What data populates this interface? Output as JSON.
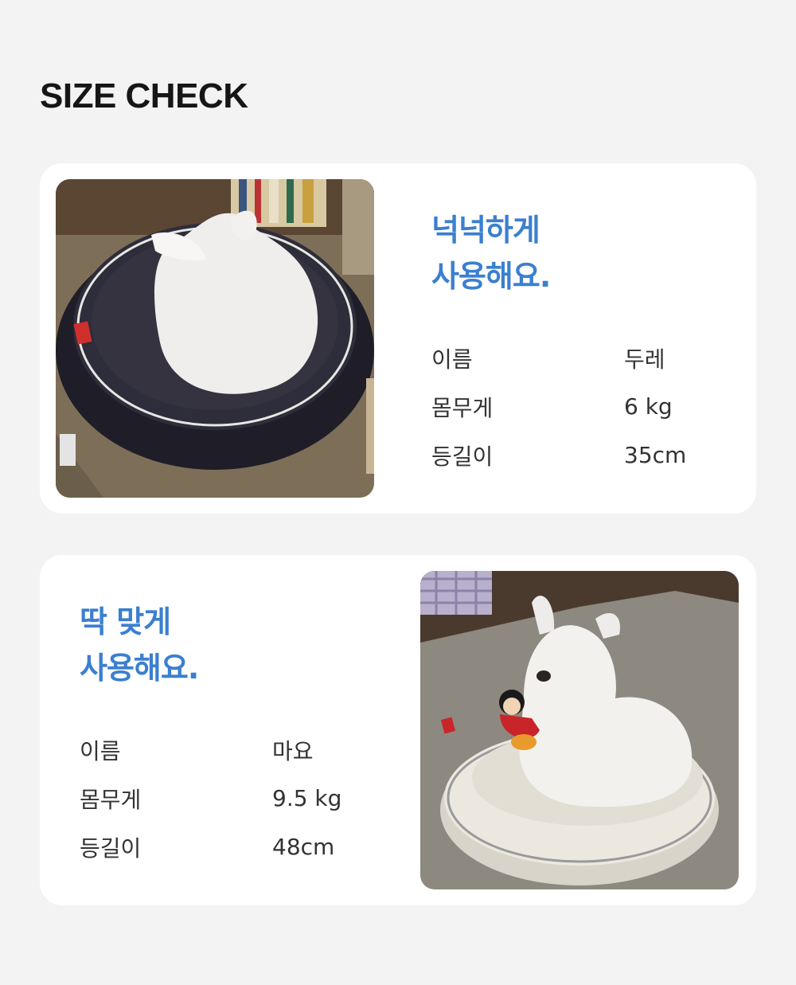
{
  "page": {
    "title": "SIZE CHECK",
    "accent_color": "#3b7fd0"
  },
  "cards": [
    {
      "headline": [
        "넉넉하게",
        "사용해요."
      ],
      "specs": [
        {
          "label": "이름",
          "value": "두레"
        },
        {
          "label": "몸무게",
          "value": "6 kg"
        },
        {
          "label": "등길이",
          "value": "35cm"
        }
      ]
    },
    {
      "headline": [
        "딱 맞게",
        "사용해요."
      ],
      "specs": [
        {
          "label": "이름",
          "value": "마요"
        },
        {
          "label": "몸무게",
          "value": "9.5 kg"
        },
        {
          "label": "등길이",
          "value": "48cm"
        }
      ]
    }
  ]
}
